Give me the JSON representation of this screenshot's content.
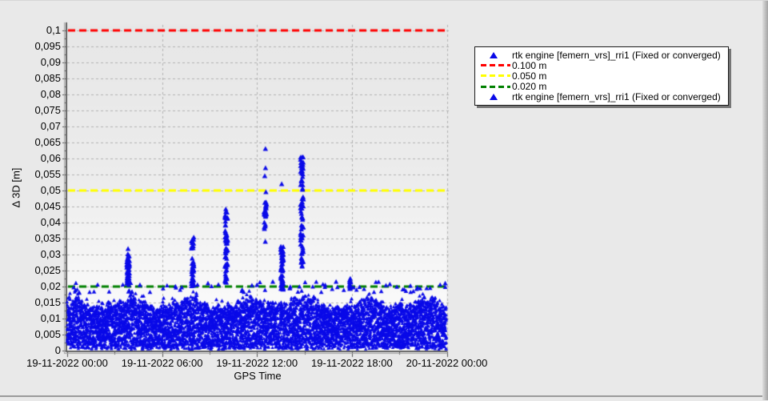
{
  "chart_data": {
    "type": "scatter",
    "series": [
      {
        "name": "rtk engine [femern_vrs]_rri1 (Fixed or converged)",
        "marker": "triangle",
        "color": "#0a0ae8"
      }
    ],
    "xlabel": "GPS Time",
    "ylabel": "Δ 3D [m]",
    "ylim": [
      0,
      0.1
    ],
    "y_step": 0.005,
    "grid": true,
    "grid_color": "#b2b2b2",
    "plot_bg_top": "#e7e7e7",
    "plot_bg_bottom": "#ffffff",
    "axis_color_dark": "#5f5f5f",
    "axis_color_light": "#a0a0a0",
    "y_tick_labels": [
      "0",
      "0,005",
      "0,01",
      "0,015",
      "0,02",
      "0,025",
      "0,03",
      "0,035",
      "0,04",
      "0,045",
      "0,05",
      "0,055",
      "0,06",
      "0,065",
      "0,07",
      "0,075",
      "0,08",
      "0,085",
      "0,09",
      "0,095",
      "0,1"
    ],
    "x_ticks": [
      {
        "label": "19-11-2022 00:00",
        "hours": 0
      },
      {
        "label": "19-11-2022 06:00",
        "hours": 6
      },
      {
        "label": "19-11-2022 12:00",
        "hours": 12
      },
      {
        "label": "19-11-2022 18:00",
        "hours": 18
      },
      {
        "label": "20-11-2022 00:00",
        "hours": 24
      }
    ],
    "x_minor_ticks_hours": [
      3,
      9,
      15,
      21
    ],
    "x_gridline_hours": [
      6,
      12,
      18,
      24
    ],
    "thresholds": [
      {
        "value": 0.1,
        "color": "#ff0000",
        "label": "0.100 m"
      },
      {
        "value": 0.05,
        "color": "#ffff00",
        "label": "0.050 m"
      },
      {
        "value": 0.02,
        "color": "#008000",
        "label": "0.020 m"
      }
    ],
    "noise_band": {
      "x_range_hours": [
        0,
        24
      ],
      "y_min": 0.0004,
      "y_top_typical": 0.016,
      "y_top_max": 0.0195,
      "triangles_per_column": 15
    },
    "scatter_outliers": {
      "count": 70,
      "y_range": [
        0.0182,
        0.0215
      ]
    },
    "marked_outliers": [
      [
        4.6,
        0.0205
      ],
      [
        8.9,
        0.021
      ],
      [
        12.0,
        0.0205
      ],
      [
        13.0,
        0.0215
      ],
      [
        17.0,
        0.0215
      ],
      [
        17.9,
        0.0225
      ],
      [
        20.4,
        0.0207
      ],
      [
        21.7,
        0.0202
      ],
      [
        23.9,
        0.021
      ]
    ],
    "spikes": [
      {
        "hours": 3.85,
        "clusters": [
          {
            "from": 0.0205,
            "to": 0.0318,
            "count": 45
          }
        ]
      },
      {
        "hours": 7.93,
        "clusters": [
          {
            "from": 0.02,
            "to": 0.0295,
            "count": 32
          },
          {
            "from": 0.0315,
            "to": 0.0358,
            "count": 12
          }
        ]
      },
      {
        "hours": 10.06,
        "clusters": [
          {
            "from": 0.021,
            "to": 0.0375,
            "count": 48
          },
          {
            "from": 0.0385,
            "to": 0.0445,
            "count": 14
          }
        ]
      },
      {
        "hours": 12.53,
        "clusters": [
          {
            "from": 0.038,
            "to": 0.047,
            "count": 26
          }
        ],
        "points": [
          0.0495,
          0.0545,
          0.057,
          0.063,
          0.034
        ]
      },
      {
        "hours": 13.59,
        "clusters": [
          {
            "from": 0.0185,
            "to": 0.0325,
            "count": 60
          }
        ],
        "points": [
          0.052
        ]
      },
      {
        "hours": 14.84,
        "clusters": [
          {
            "from": 0.026,
            "to": 0.0485,
            "count": 48
          },
          {
            "from": 0.0502,
            "to": 0.0615,
            "count": 26
          }
        ]
      },
      {
        "hours": 17.86,
        "clusters": [
          {
            "from": 0.019,
            "to": 0.0225,
            "count": 10
          }
        ]
      }
    ]
  },
  "legend": {
    "entries": [
      {
        "marker": "triangle",
        "color": "#0a0ae8",
        "label": "rtk engine [femern_vrs]_rri1 (Fixed or converged)"
      },
      {
        "marker": "dashes",
        "color": "#ff0000",
        "label": "0.100 m"
      },
      {
        "marker": "dashes",
        "color": "#ffff00",
        "label": "0.050 m"
      },
      {
        "marker": "dashes",
        "color": "#008000",
        "label": "0.020 m"
      },
      {
        "marker": "triangle",
        "color": "#0a0ae8",
        "label": "rtk engine [femern_vrs]_rri1 (Fixed or converged)"
      }
    ]
  }
}
